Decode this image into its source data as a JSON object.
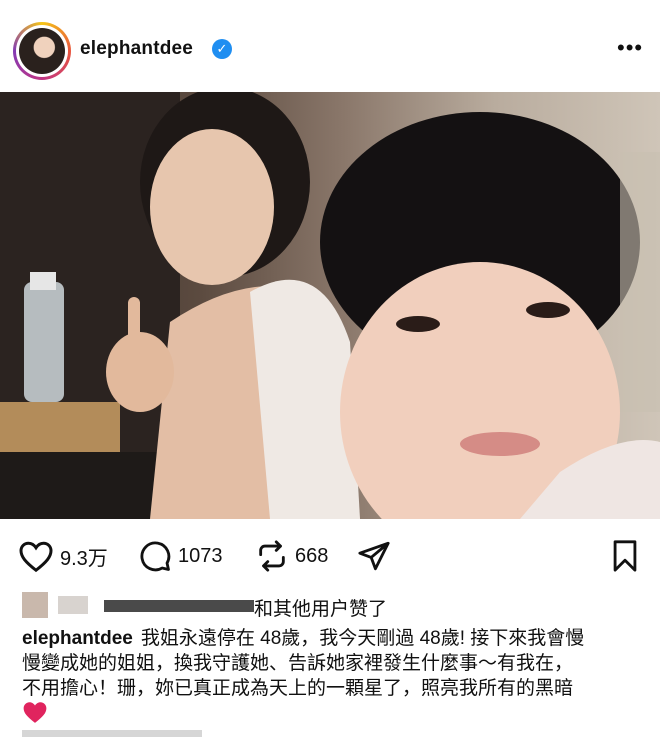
{
  "post": {
    "username": "elephantdee",
    "verified_icon": "verified-check-icon",
    "more_icon": "more-options-icon"
  },
  "actions": {
    "likes_count": "9.3万",
    "comments_count": "1073",
    "reposts_count": "668"
  },
  "likes": {
    "text": "和其他用户赞了"
  },
  "caption": {
    "username": "elephantdee",
    "line1": "我姐永遠停在 48歲，我今天剛過 48歲! 接下來我會慢",
    "line2": "慢變成她的姐姐，換我守護她、告訴她家裡發生什麼事～有我在，",
    "line3": "不用擔心！珊，妳已真正成為天上的一顆星了，照亮我所有的黑暗",
    "emoji": "❤️"
  },
  "colors": {
    "verified_blue": "#1f8ef1",
    "heart_red": "#e0245e"
  }
}
